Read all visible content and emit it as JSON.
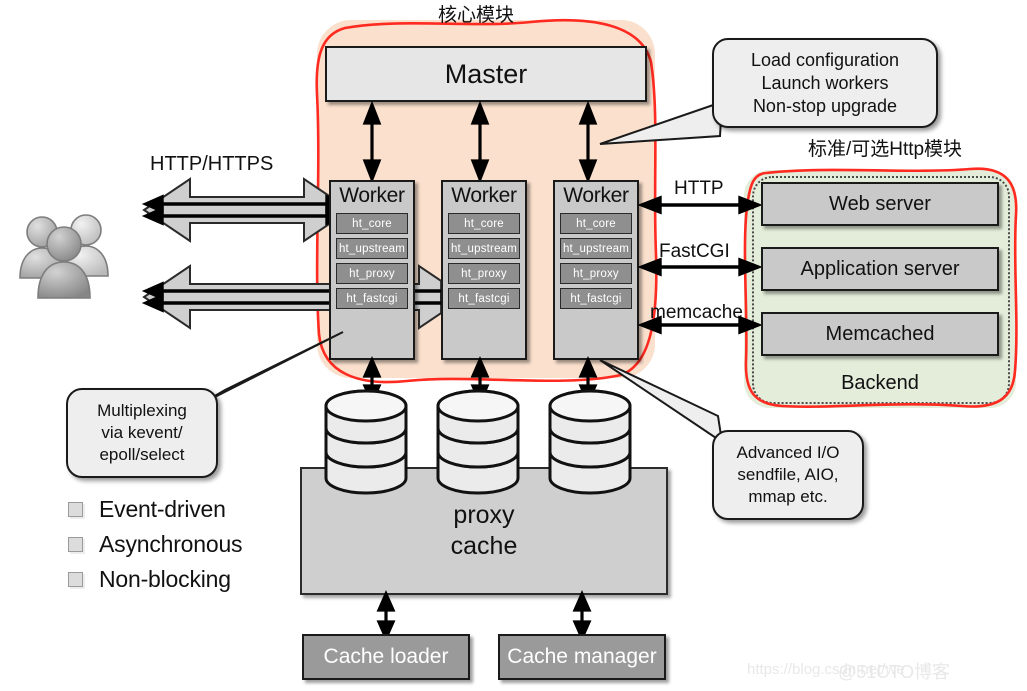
{
  "regions": {
    "core_title": "核心模块",
    "http_title": "标准/可选Http模块"
  },
  "core": {
    "master_label": "Master",
    "workers": [
      {
        "title": "Worker",
        "modules": [
          "ht_core",
          "ht_upstream",
          "ht_proxy",
          "ht_fastcgi"
        ]
      },
      {
        "title": "Worker",
        "modules": [
          "ht_core",
          "ht_upstream",
          "ht_proxy",
          "ht_fastcgi"
        ]
      },
      {
        "title": "Worker",
        "modules": [
          "ht_core",
          "ht_upstream",
          "ht_proxy",
          "ht_fastcgi"
        ]
      }
    ]
  },
  "backend": {
    "items": [
      "Web server",
      "Application server",
      "Memcached"
    ],
    "label": "Backend"
  },
  "connections": {
    "client_protocol": "HTTP/HTTPS",
    "http": "HTTP",
    "fastcgi": "FastCGI",
    "memcache": "memcache"
  },
  "callouts": {
    "master": "Load configuration\nLaunch workers\nNon-stop upgrade",
    "multiplexing": "Multiplexing\nvia kevent/\nepoll/select",
    "advanced_io": "Advanced I/O\nsendfile, AIO,\nmmap etc."
  },
  "cache": {
    "proxy_cache_label": "proxy\ncache",
    "loader": "Cache loader",
    "manager": "Cache manager"
  },
  "features": [
    "Event-driven",
    "Asynchronous",
    "Non-blocking"
  ],
  "watermark": {
    "url": "https://blog.csdn.net/we",
    "site": "@51CTO博客"
  },
  "colors": {
    "core_region": "#fae0cd",
    "http_region": "#e3edd9",
    "region_border": "#ff2a20",
    "box_light": "#e6e6e6",
    "box_mid": "#c9c9c9",
    "module_box": "#8f8f8f",
    "proxy_cache": "#cfcfcf"
  }
}
